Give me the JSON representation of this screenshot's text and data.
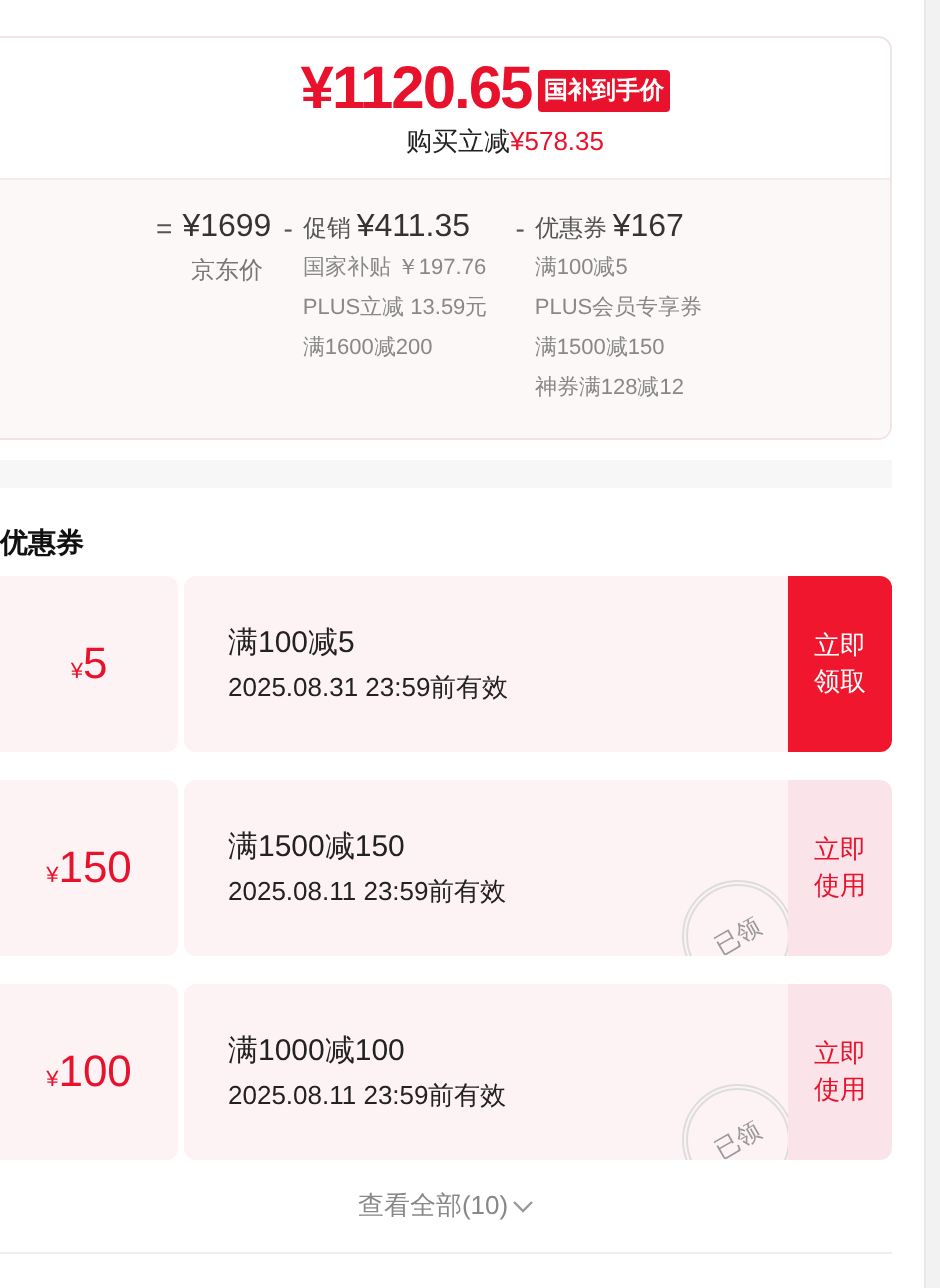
{
  "price_card": {
    "final_price": "¥1120.65",
    "tag": "国补到手价",
    "saving_label": "购买立减",
    "saving_amount": "¥578.35",
    "breakdown": [
      {
        "operator": "=",
        "amount": "¥1699",
        "caption": "京东价"
      },
      {
        "operator": "-",
        "label": "促销",
        "amount": "¥411.35",
        "details": [
          "国家补贴 ￥197.76",
          "PLUS立减 13.59元",
          "满1600减200"
        ]
      },
      {
        "operator": "-",
        "label": "优惠券",
        "amount": "¥167",
        "details": [
          "满100减5",
          "PLUS会员专享券",
          "满1500减150",
          "神券满128减12"
        ]
      }
    ]
  },
  "coupon_section": {
    "title": "优惠券",
    "coupons": [
      {
        "currency": "¥",
        "value": "5",
        "title": "满100减5",
        "validity": "2025.08.31 23:59前有效",
        "action": [
          "立即",
          "领取"
        ],
        "claimed": false
      },
      {
        "currency": "¥",
        "value": "150",
        "title": "满1500减150",
        "validity": "2025.08.11 23:59前有效",
        "action": [
          "立即",
          "使用"
        ],
        "claimed": true,
        "stamp": "已领"
      },
      {
        "currency": "¥",
        "value": "100",
        "title": "满1000减100",
        "validity": "2025.08.11 23:59前有效",
        "action": [
          "立即",
          "使用"
        ],
        "claimed": true,
        "stamp": "已领"
      }
    ],
    "view_all": "查看全部(10)"
  }
}
